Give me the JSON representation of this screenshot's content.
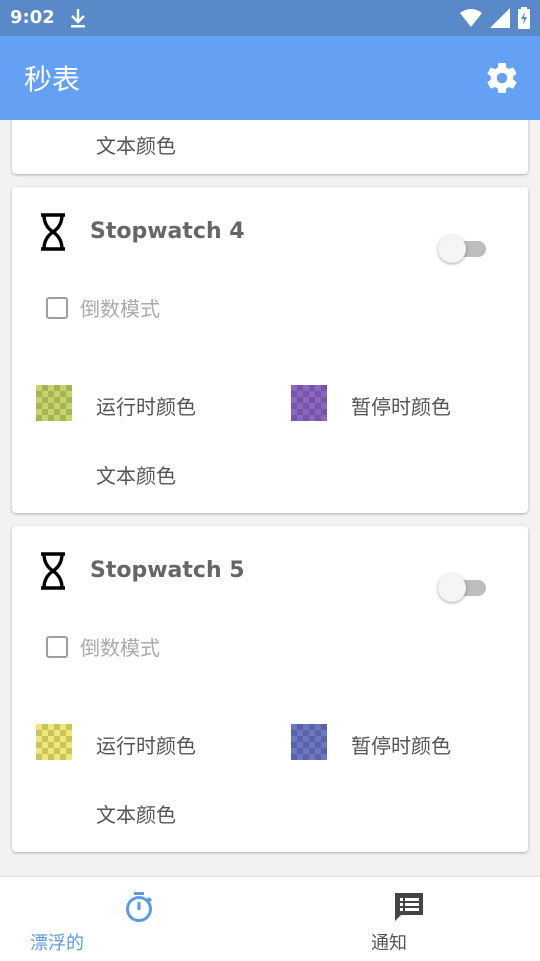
{
  "status_bar": {
    "time": "9:02"
  },
  "app_bar": {
    "title": "秒表"
  },
  "colors": {
    "app_bar": "#64a0f3",
    "status_bar": "#5a89c9",
    "active_nav": "#5b9ae8"
  },
  "partial_card": {
    "text_color_label": "文本颜色"
  },
  "stopwatches": [
    {
      "name": "Stopwatch 4",
      "enabled": false,
      "countdown_label": "倒数模式",
      "countdown_checked": false,
      "running_color_label": "运行时颜色",
      "paused_color_label": "暂停时颜色",
      "text_color_label": "文本颜色",
      "running_color": "#c8d46a",
      "paused_color": "#8a67c4"
    },
    {
      "name": "Stopwatch 5",
      "enabled": false,
      "countdown_label": "倒数模式",
      "countdown_checked": false,
      "running_color_label": "运行时颜色",
      "paused_color_label": "暂停时颜色",
      "text_color_label": "文本颜色",
      "running_color": "#f0e874",
      "paused_color": "#6b77c4"
    }
  ],
  "bottom_nav": {
    "items": [
      {
        "label": "漂浮的",
        "icon": "stopwatch-icon",
        "active": true
      },
      {
        "label": "通知",
        "icon": "notification-icon",
        "active": false
      }
    ]
  }
}
